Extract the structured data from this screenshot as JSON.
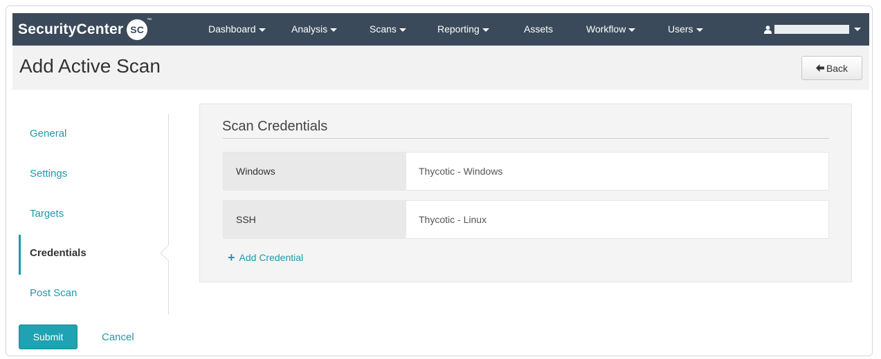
{
  "brand": {
    "name": "SecurityCenter",
    "badge": "SC",
    "trademark": "™"
  },
  "nav": {
    "items": [
      {
        "label": "Dashboard",
        "has_dropdown": true
      },
      {
        "label": "Analysis",
        "has_dropdown": true
      },
      {
        "label": "Scans",
        "has_dropdown": true
      },
      {
        "label": "Reporting",
        "has_dropdown": true
      },
      {
        "label": "Assets",
        "has_dropdown": false
      },
      {
        "label": "Workflow",
        "has_dropdown": true
      },
      {
        "label": "Users",
        "has_dropdown": true
      }
    ],
    "user_icon": "user-icon"
  },
  "page": {
    "title": "Add Active Scan",
    "back_label": "Back",
    "back_icon": "arrow-left-icon"
  },
  "sidebar": {
    "items": [
      {
        "label": "General",
        "active": false
      },
      {
        "label": "Settings",
        "active": false
      },
      {
        "label": "Targets",
        "active": false
      },
      {
        "label": "Credentials",
        "active": true
      },
      {
        "label": "Post Scan",
        "active": false
      }
    ]
  },
  "panel": {
    "title": "Scan Credentials",
    "credentials": [
      {
        "type": "Windows",
        "value": "Thycotic - Windows"
      },
      {
        "type": "SSH",
        "value": "Thycotic - Linux"
      }
    ],
    "add_label": "Add Credential",
    "add_icon": "plus-icon"
  },
  "actions": {
    "submit": "Submit",
    "cancel": "Cancel"
  },
  "colors": {
    "navbar": "#3b4a5a",
    "accent": "#1a9aab",
    "submit": "#1fa2b1"
  }
}
